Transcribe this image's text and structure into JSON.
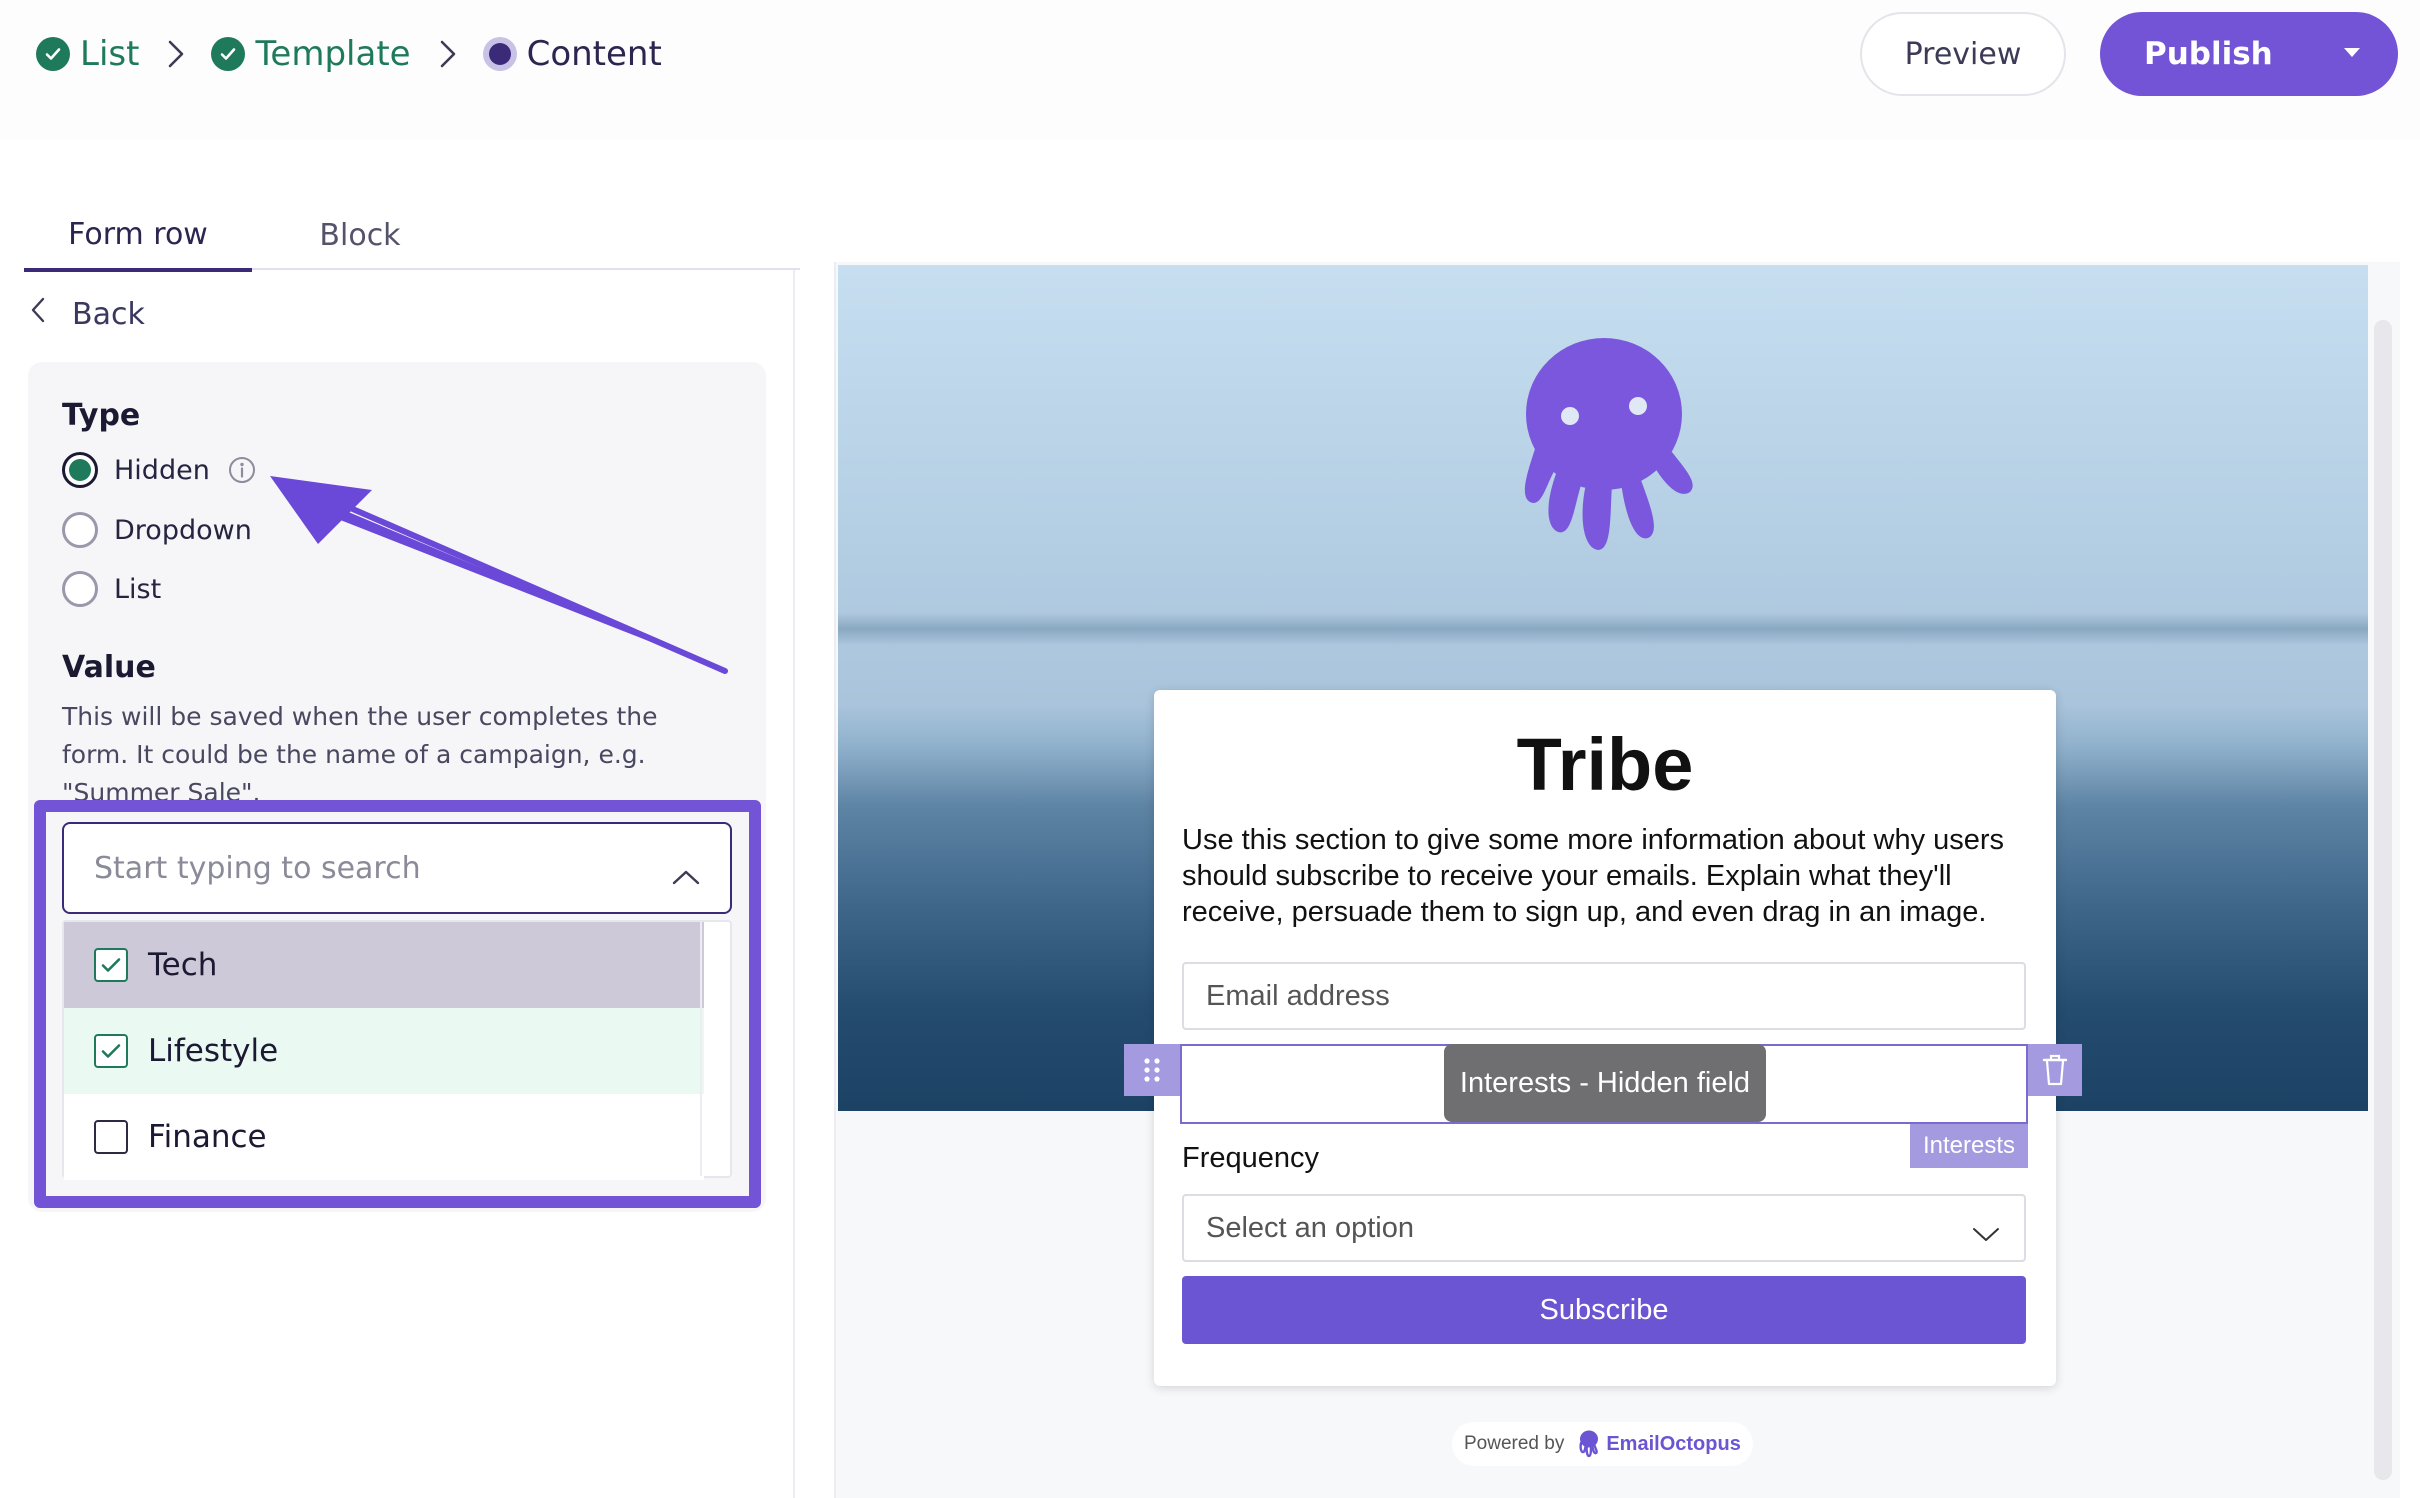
{
  "breadcrumb": {
    "steps": [
      {
        "label": "List",
        "state": "done"
      },
      {
        "label": "Template",
        "state": "done"
      },
      {
        "label": "Content",
        "state": "current"
      }
    ]
  },
  "header": {
    "preview_label": "Preview",
    "publish_label": "Publish"
  },
  "tabs": [
    {
      "label": "Form row",
      "active": true
    },
    {
      "label": "Block",
      "active": false
    }
  ],
  "back_label": "Back",
  "type_section": {
    "label": "Type",
    "options": [
      {
        "label": "Hidden",
        "selected": true
      },
      {
        "label": "Dropdown",
        "selected": false
      },
      {
        "label": "List",
        "selected": false
      }
    ]
  },
  "value_section": {
    "label": "Value",
    "help": "This will be saved when the user completes the form. It could be the name of a campaign, e.g. \"Summer Sale\".",
    "search_placeholder": "Start typing to search",
    "options": [
      {
        "label": "Tech",
        "checked": true
      },
      {
        "label": "Lifestyle",
        "checked": true
      },
      {
        "label": "Finance",
        "checked": false
      }
    ]
  },
  "form_preview": {
    "title": "Tribe",
    "description": "Use this section to give some more information about why users should subscribe to receive your emails. Explain what they'll receive, persuade them to sign up, and even drag in an image.",
    "email_placeholder": "Email address",
    "hidden_field_tooltip": "Interests - Hidden field",
    "hidden_field_tag": "Interests",
    "frequency_label": "Frequency",
    "frequency_placeholder": "Select an option",
    "subscribe_label": "Subscribe",
    "powered_by": "Powered by",
    "brand": "EmailOctopus"
  },
  "colors": {
    "accent": "#7353d6",
    "success": "#1f7a5c",
    "dark_purple": "#3b2a78",
    "octopus": "#7a57dd"
  },
  "icons": [
    "check-icon",
    "chevron-right-icon",
    "chevron-left-icon",
    "chevron-up-icon",
    "chevron-down-icon",
    "info-icon",
    "drag-handle-icon",
    "trash-icon",
    "octopus-logo"
  ]
}
